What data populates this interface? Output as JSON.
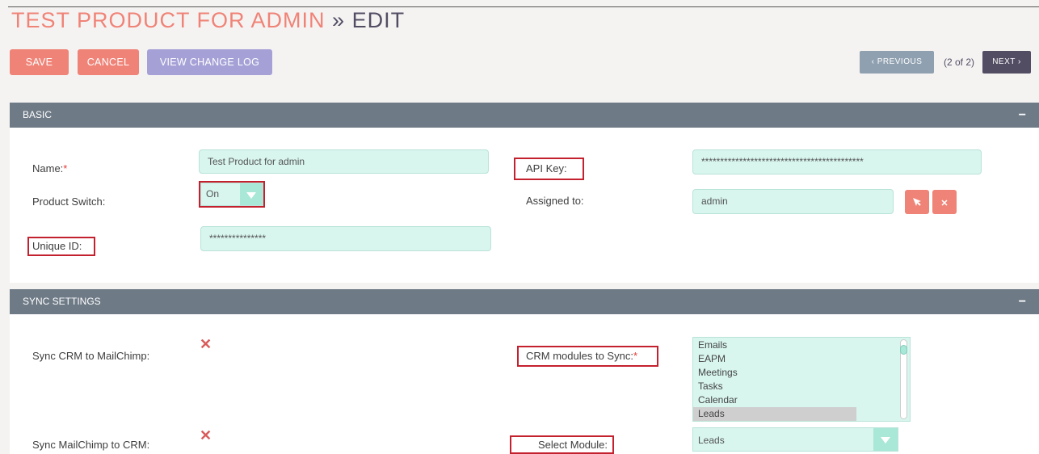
{
  "header": {
    "title_product": "TEST PRODUCT FOR ADMIN",
    "title_separator": "»",
    "title_mode": "EDIT"
  },
  "actions": {
    "save": "SAVE",
    "cancel": "CANCEL",
    "view_change_log": "VIEW CHANGE LOG"
  },
  "pagination": {
    "previous": "‹ PREVIOUS",
    "count": "(2 of 2)",
    "next": "NEXT ›"
  },
  "basic": {
    "title": "BASIC",
    "collapse": "−",
    "name_label": "Name:",
    "required_mark": "*",
    "name_value": "Test Product for admin",
    "product_switch_label": "Product Switch:",
    "product_switch_value": "On",
    "unique_id_label": "Unique ID:",
    "unique_id_value": "***************",
    "api_key_label": "API Key:",
    "api_key_value": "*******************************************",
    "assigned_to_label": "Assigned to:",
    "assigned_to_value": "admin"
  },
  "sync": {
    "title": "SYNC SETTINGS",
    "collapse": "−",
    "sync_crm_label": "Sync CRM to MailChimp:",
    "sync_mc_label": "Sync MailChimp to CRM:",
    "unchecked_mark": "✕",
    "crm_modules_label": "CRM modules to Sync:",
    "required_mark": "*",
    "modules": [
      "Emails",
      "EAPM",
      "Meetings",
      "Tasks",
      "Calendar",
      "Leads"
    ],
    "selected_module_index": 5,
    "select_module_label": "Select Module:",
    "select_module_value": "Leads"
  },
  "icons": {
    "select_arrow": "chevron-down-icon",
    "assign_select": "cursor-arrow-icon",
    "assign_clear": "close-icon"
  },
  "colors": {
    "accent": "#f08377",
    "secondary": "#a5a1d6",
    "panel_header": "#6e7a86",
    "input_bg": "#d8f5ee",
    "highlight_box": "#c4212e"
  }
}
